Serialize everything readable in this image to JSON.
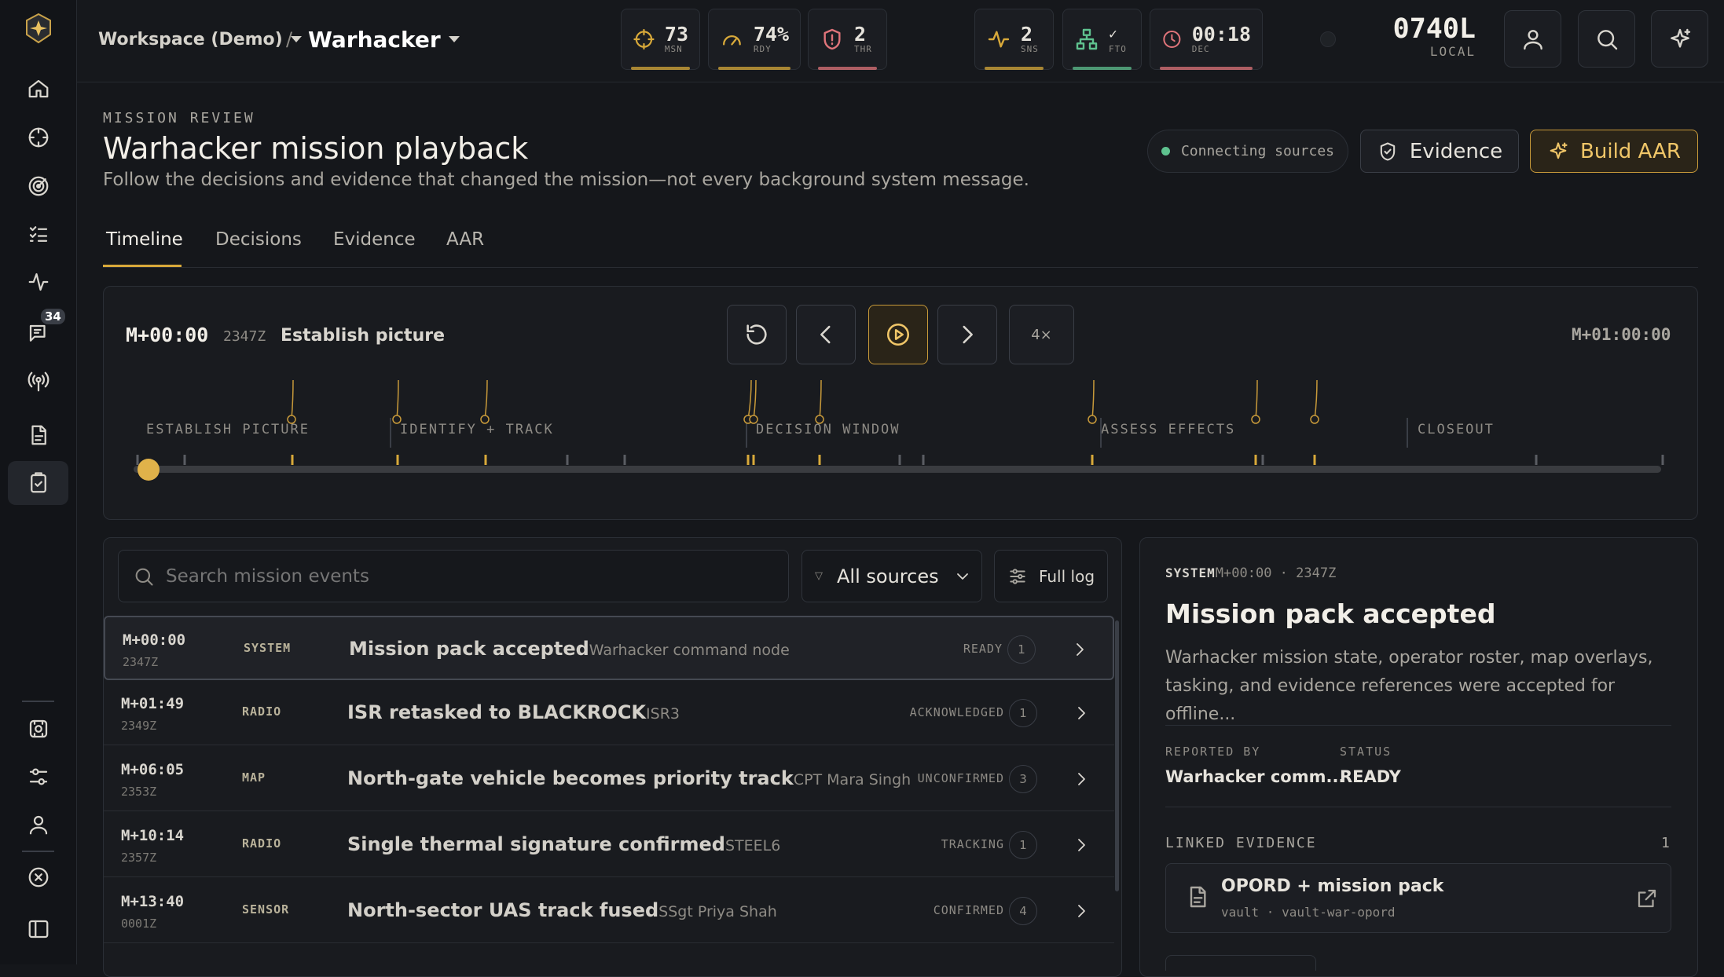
{
  "rail": {
    "items": [
      "home",
      "target",
      "radar",
      "checklist",
      "activity",
      "messages",
      "broadcast",
      "documents",
      "review",
      "operations",
      "sliders",
      "user",
      "cancel",
      "panel"
    ],
    "messages_badge": "34"
  },
  "topbar": {
    "workspace": "Workspace (Demo)",
    "separator": "/",
    "project": "Warhacker",
    "metrics": [
      {
        "value": "73",
        "label": "MSN",
        "color": "#d8a93a"
      },
      {
        "value": "74%",
        "label": "RDY",
        "color": "#d8a93a"
      },
      {
        "value": "2",
        "label": "THR",
        "color": "#e0747a"
      },
      {
        "value": "2",
        "label": "SNS",
        "color": "#d8a93a"
      },
      {
        "value": "✓",
        "label": "FTO",
        "color": "#5fc28f"
      },
      {
        "value": "00:18",
        "label": "DEC",
        "color": "#e0747a"
      }
    ],
    "clock": "0740L",
    "clock_zone": "LOCAL"
  },
  "header": {
    "eyebrow": "MISSION REVIEW",
    "title": "Warhacker mission playback",
    "subtitle": "Follow the decisions and evidence that changed the mission—not every background system message.",
    "connection": "Connecting sources",
    "evidence_label": "Evidence",
    "build_label": "Build AAR"
  },
  "tabs": [
    "Timeline",
    "Decisions",
    "Evidence",
    "AAR"
  ],
  "playback": {
    "current": "M+00:00",
    "zulu": "2347Z",
    "phase_name": "Establish picture",
    "speed": "4×",
    "end": "M+01:00:00",
    "phases": [
      "ESTABLISH PICTURE",
      "IDENTIFY + TRACK",
      "DECISION WINDOW",
      "ASSESS EFFECTS",
      "CLOSEOUT"
    ],
    "progress": 0
  },
  "events": {
    "search_placeholder": "Search mission events",
    "source_filter": "All sources",
    "full_log": "Full log",
    "rows": [
      {
        "t": "M+00:00",
        "z": "2347Z",
        "src": "SYSTEM",
        "title": "Mission pack accepted",
        "by": "Warhacker command node",
        "status": "READY",
        "count": "1"
      },
      {
        "t": "M+01:49",
        "z": "2349Z",
        "src": "RADIO",
        "title": "ISR retasked to BLACKROCK",
        "by": "ISR3",
        "status": "ACKNOWLEDGED",
        "count": "1"
      },
      {
        "t": "M+06:05",
        "z": "2353Z",
        "src": "MAP",
        "title": "North-gate vehicle becomes priority track",
        "by": "CPT Mara Singh",
        "status": "UNCONFIRMED",
        "count": "3"
      },
      {
        "t": "M+10:14",
        "z": "2357Z",
        "src": "RADIO",
        "title": "Single thermal signature confirmed",
        "by": "STEEL6",
        "status": "TRACKING",
        "count": "1"
      },
      {
        "t": "M+13:40",
        "z": "0001Z",
        "src": "SENSOR",
        "title": "North-sector UAS track fused",
        "by": "SSgt Priya Shah",
        "status": "CONFIRMED",
        "count": "4"
      }
    ]
  },
  "detail": {
    "source": "SYSTEM",
    "meta": "M+00:00 · 2347Z",
    "title": "Mission pack accepted",
    "body": "Warhacker mission state, operator roster, map overlays, tasking, and evidence references were accepted for offline...",
    "reported_by_label": "REPORTED BY",
    "reported_by": "Warhacker comm...",
    "status_label": "STATUS",
    "status": "READY",
    "linked_label": "LINKED EVIDENCE",
    "linked_count": "1",
    "evidence_title": "OPORD + mission pack",
    "evidence_meta": "vault · vault-war-opord"
  }
}
